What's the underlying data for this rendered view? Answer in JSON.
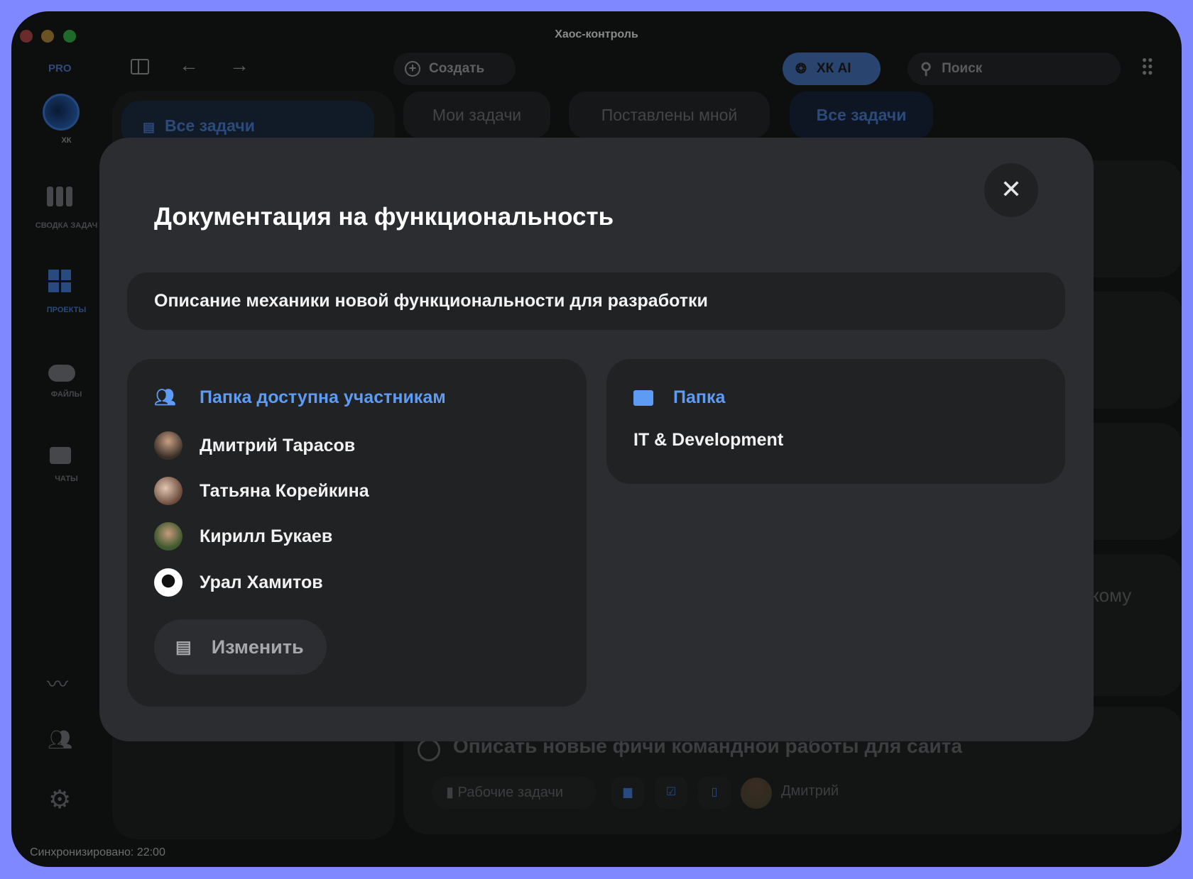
{
  "window": {
    "title": "Хаос-контроль"
  },
  "toolbar": {
    "pro": "PRO",
    "create": "Создать",
    "ai": "ХК AI",
    "search_placeholder": "Поиск"
  },
  "sidebar": {
    "logo_label": "ХК",
    "items": [
      {
        "label": "СВОДКА ЗАДАЧ"
      },
      {
        "label": "ПРОЕКТЫ"
      },
      {
        "label": "ФАЙЛЫ"
      },
      {
        "label": "ЧАТЫ"
      }
    ]
  },
  "background": {
    "left_filter": "Все задачи",
    "tabs": [
      "Мои задачи",
      "Поставлены мной",
      "Все задачи"
    ],
    "partial_text": "кому",
    "task_title": "Описать новые фичи командной работы для сайта",
    "task_folder": "Рабочие задачи",
    "task_assignee": "Дмитрий"
  },
  "modal": {
    "title": "Документация на функциональность",
    "description": "Описание механики новой функциональности для разработки",
    "access_label": "Папка доступна участникам",
    "members": [
      "Дмитрий Тарасов",
      "Татьяна Корейкина",
      "Кирилл Букаев",
      "Урал Хамитов"
    ],
    "edit_button": "Изменить",
    "folder_label": "Папка",
    "folder_name": "IT & Development"
  },
  "status": {
    "sync": "Синхронизировано: 22:00"
  },
  "colors": {
    "accent": "#5d9bf5",
    "frame": "#8088ff"
  }
}
